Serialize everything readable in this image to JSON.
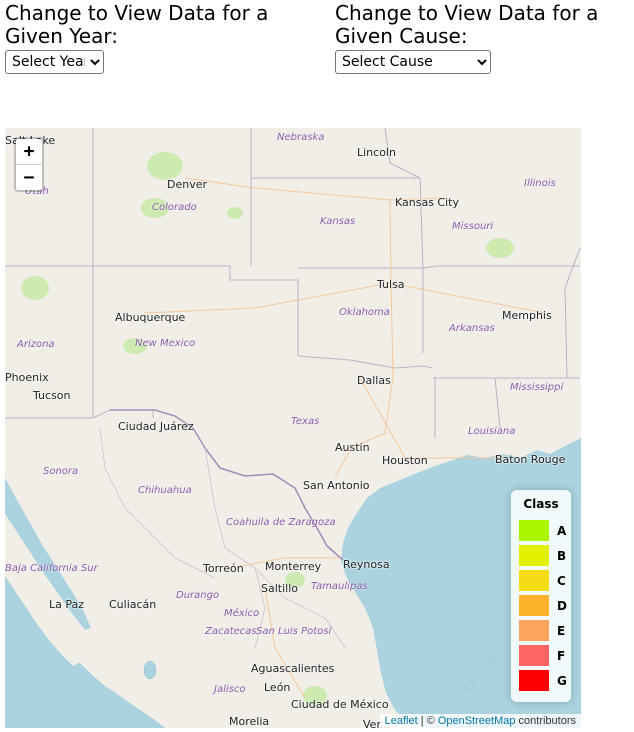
{
  "controls": {
    "year": {
      "label": "Change to View Data for a Given Year:",
      "selected": "Select Year"
    },
    "cause": {
      "label": "Change to View Data for a Given Cause:",
      "selected": "Select Cause"
    }
  },
  "map": {
    "zoom_in": "+",
    "zoom_out": "−",
    "cities": [
      "Salt Lake",
      "Lincoln",
      "Denver",
      "Kansas City",
      "Tulsa",
      "Albuquerque",
      "Memphis",
      "Phoenix",
      "Tucson",
      "Dallas",
      "Ciudad Juárez",
      "Austin",
      "Houston",
      "Baton Rouge",
      "San Antonio",
      "Reynosa",
      "Monterrey",
      "Torreón",
      "Saltillo",
      "La Paz",
      "Culiacán",
      "Aguascalientes",
      "León",
      "Ciudad de México",
      "Morelia",
      "Ver..."
    ],
    "regions": [
      "Nebraska",
      "Illinois",
      "Utah",
      "Colorado",
      "Kansas",
      "Missouri",
      "Arizona",
      "New Mexico",
      "Oklahoma",
      "Arkansas",
      "Mississippi",
      "Texas",
      "Louisiana",
      "Sonora",
      "Chihuahua",
      "Coahuila de Zaragoza",
      "Baja California Sur",
      "Durango",
      "Tamaulipas",
      "Zacatecas",
      "San Luis Potosí",
      "México",
      "Jalisco"
    ],
    "legend": {
      "title": "Class",
      "items": [
        {
          "label": "A",
          "color": "#aaf500"
        },
        {
          "label": "B",
          "color": "#e0f000"
        },
        {
          "label": "C",
          "color": "#f5dc14"
        },
        {
          "label": "D",
          "color": "#fbb42a"
        },
        {
          "label": "E",
          "color": "#fca35e"
        },
        {
          "label": "F",
          "color": "#fd6466"
        },
        {
          "label": "G",
          "color": "#ff0000"
        }
      ]
    },
    "attribution": {
      "leaflet": "Leaflet",
      "sep": " | © ",
      "osm": "OpenStreetMap",
      "suffix": " contributors"
    }
  }
}
